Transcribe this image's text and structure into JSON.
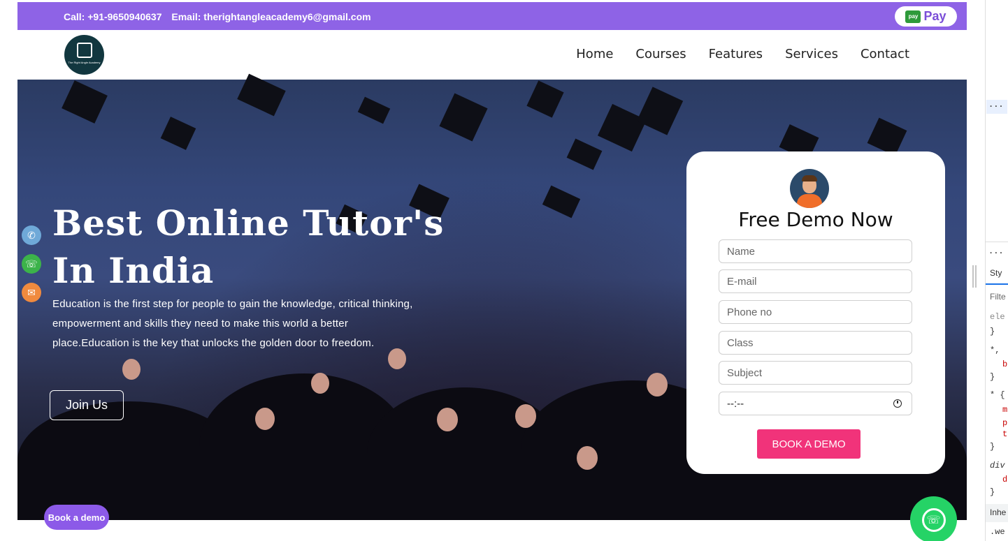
{
  "topbar": {
    "call": "Call: +91-9650940637",
    "email": "Email: therightangleacademy6@gmail.com",
    "pay_label": "Pay",
    "gpay_badge": "pay"
  },
  "logo": {
    "text": "The Right Angle Academy"
  },
  "nav": {
    "items": [
      {
        "label": "Home"
      },
      {
        "label": "Courses"
      },
      {
        "label": "Features"
      },
      {
        "label": "Services"
      },
      {
        "label": "Contact"
      }
    ]
  },
  "hero": {
    "title_line1": "Best Online Tutor's",
    "title_line2": "In India",
    "description": "Education is the first step for people to gain the knowledge, critical thinking, empowerment and skills they need to make this world a better place.Education is the key that unlocks the golden door to freedom.",
    "join_label": "Join Us"
  },
  "side_icons": [
    "phone-icon",
    "whatsapp-icon",
    "mail-icon"
  ],
  "form": {
    "title": "Free Demo Now",
    "name_placeholder": "Name",
    "email_placeholder": "E-mail",
    "phone_placeholder": "Phone no",
    "class_placeholder": "Class",
    "subject_placeholder": "Subject",
    "time_value": "--:--",
    "submit_label": "BOOK A DEMO"
  },
  "floating": {
    "book_label": "Book a demo"
  },
  "devtools": {
    "dots": "...",
    "tab_styles": "Sty",
    "filter": "Filte",
    "rows": [
      "ele",
      "}",
      "*,",
      "b",
      "}",
      "* {",
      "m",
      "p",
      "t",
      "}",
      "div",
      "d",
      "}",
      "Inhe",
      ".we"
    ]
  },
  "colors": {
    "topbar": "#8e63e6",
    "submit": "#f1337a",
    "whatsapp": "#25d366",
    "book_float": "#8c5ae8"
  }
}
